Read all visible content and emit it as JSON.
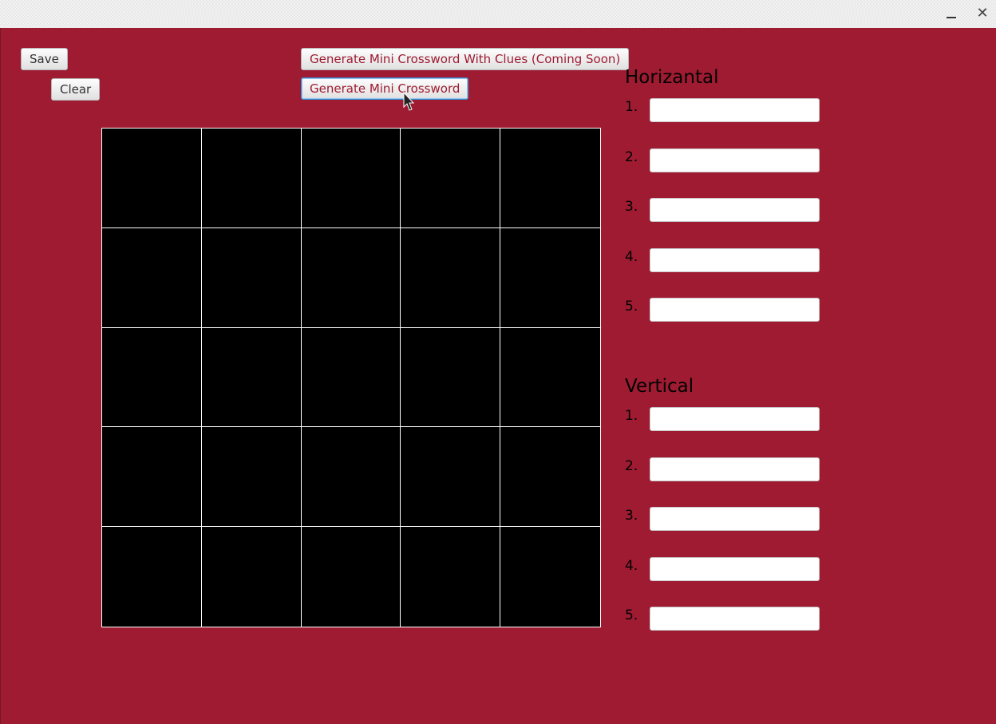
{
  "window": {
    "minimize_icon": "minimize-icon",
    "close_glyph": "✕"
  },
  "toolbar": {
    "save_label": "Save",
    "clear_label": "Clear",
    "generate_with_clues_label": "Generate Mini Crossword With Clues (Coming Soon)",
    "generate_label": "Generate Mini Crossword"
  },
  "grid": {
    "rows": 5,
    "cols": 5
  },
  "horizontal": {
    "title": "Horizantal",
    "clues": [
      {
        "number": "1.",
        "value": ""
      },
      {
        "number": "2.",
        "value": ""
      },
      {
        "number": "3.",
        "value": ""
      },
      {
        "number": "4.",
        "value": ""
      },
      {
        "number": "5.",
        "value": ""
      }
    ]
  },
  "vertical": {
    "title": "Vertical",
    "clues": [
      {
        "number": "1.",
        "value": ""
      },
      {
        "number": "2.",
        "value": ""
      },
      {
        "number": "3.",
        "value": ""
      },
      {
        "number": "4.",
        "value": ""
      },
      {
        "number": "5.",
        "value": ""
      }
    ]
  },
  "colors": {
    "background": "#9e1b32",
    "grid_cell": "#000000",
    "grid_line": "#ffffff",
    "accent_text": "#9e1b32"
  }
}
